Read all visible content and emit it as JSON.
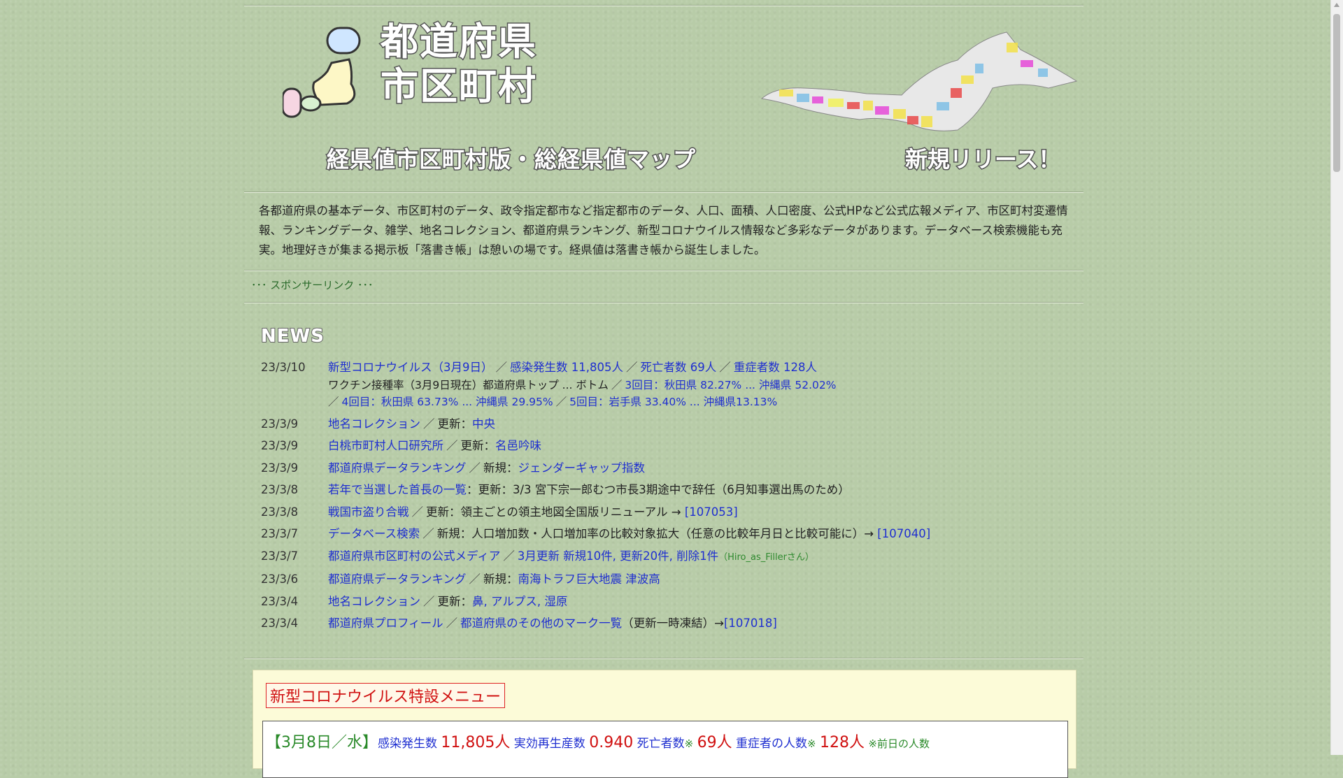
{
  "header": {
    "title_line1": "都道府県",
    "title_line2": "市区町村",
    "subtitle": "経県値市区町村版・総経県値マップ",
    "new_release": "新規リリース！"
  },
  "intro_text": "各都道府県の基本データ、市区町村のデータ、政令指定都市など指定都市のデータ、人口、面積、人口密度、公式HPなど公式広報メディア、市区町村変遷情報、ランキングデータ、雑学、地名コレクション、都道府県ランキング、新型コロナウイルス情報など多彩なデータがあります。データベース検索機能も充実。地理好きが集まる掲示板「落書き帳」は憩いの場です。経県値は落書き帳から誕生しました。",
  "sponsor": "･･･ スポンサーリンク ･･･",
  "news_heading": "NEWS",
  "news": [
    {
      "date": "23/3/10",
      "l1a": "新型コロナウイルス（3月9日）",
      "l1b": "感染発生数 11,805人",
      "l1c": "死亡者数 69人",
      "l1d": "重症者数 128人",
      "l2a": "ワクチン接種率（3月9日現在）都道府県トップ ... ボトム",
      "l2b": "3回目：秋田県 82.27% ... 沖縄県 52.02%",
      "l3a": "4回目：秋田県 63.73% ... 沖縄県 29.95%",
      "l3b": "5回目：岩手県 33.40% ... 沖縄県13.13%"
    },
    {
      "date": "23/3/9",
      "link": "地名コレクション",
      "text": "更新：",
      "link2": "中央"
    },
    {
      "date": "23/3/9",
      "link": "白桃市町村人口研究所",
      "text": "更新：",
      "link2": "名邑吟味"
    },
    {
      "date": "23/3/9",
      "link": "都道府県データランキング",
      "text": "新規：",
      "link2": "ジェンダーギャップ指数"
    },
    {
      "date": "23/3/8",
      "link": "若年で当選した首長の一覧",
      "text": "：更新：3/3 宮下宗一郎むつ市長3期途中で辞任（6月知事選出馬のため）"
    },
    {
      "date": "23/3/8",
      "link": "戦国市盗り合戦",
      "text": "更新：領主ごとの領主地図全国版リニューアル →",
      "link2": "[107053]"
    },
    {
      "date": "23/3/7",
      "link": "データベース検索",
      "text": "新規：人口増加数・人口増加率の比較対象拡大（任意の比較年月日と比較可能に）→",
      "link2": "[107040]"
    },
    {
      "date": "23/3/7",
      "link": "都道府県市区町村の公式メディア",
      "link2": "3月更新 新規10件, 更新20件, 削除1件",
      "note": "（Hiro_as_Fillerさん）"
    },
    {
      "date": "23/3/6",
      "link": "都道府県データランキング",
      "text": "新規：",
      "link2": "南海トラフ巨大地震 津波高"
    },
    {
      "date": "23/3/4",
      "link": "地名コレクション",
      "text": "更新：",
      "link2": "鼻, アルプス, 湿原"
    },
    {
      "date": "23/3/4",
      "link": "都道府県プロフィール",
      "link2": "都道府県のその他のマーク一覧",
      "text": "（更新一時凍結）→",
      "link3": "[107018]"
    }
  ],
  "corona": {
    "title": "新型コロナウイルス特設メニュー",
    "date": "【3月8日／水】",
    "l_infect": "感染発生数",
    "v_infect": "11,805人",
    "l_rt": "実効再生産数",
    "v_rt": "0.940",
    "l_death": "死亡者数",
    "mark": "※",
    "v_death": "69人",
    "l_severe": "重症者の人数",
    "v_severe": "128人",
    "note": "※前日の人数"
  }
}
